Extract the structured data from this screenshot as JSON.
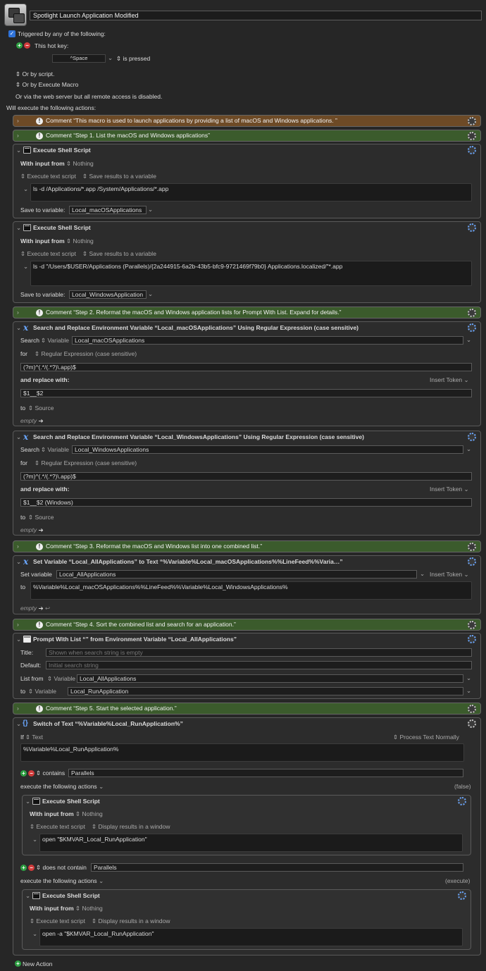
{
  "macro": {
    "name": "Spotlight Launch Application Modified"
  },
  "triggers": {
    "triggered_label": "Triggered by any of the following:",
    "hotkey_label": "This hot key:",
    "hotkey_value": "^Space",
    "hotkey_state": "is pressed",
    "by_script": "Or by script.",
    "by_execute": "Or by Execute Macro",
    "web": "Or via the web server but all remote access is disabled.",
    "will_execute": "Will execute the following actions:"
  },
  "common": {
    "execute_shell": "Execute Shell Script",
    "with_input": "With input from",
    "nothing": "Nothing",
    "execute_text": "Execute text script",
    "save_results": "Save results to a variable",
    "display_results": "Display results in a window",
    "save_to_var": "Save to variable:",
    "search": "Search",
    "variable": "Variable",
    "for": "for",
    "regex": "Regular Expression (case sensitive)",
    "replace_with": "and replace with:",
    "insert_token": "Insert Token",
    "to": "to",
    "source": "Source",
    "empty": "empty",
    "set_variable": "Set variable",
    "title": "Title:",
    "default": "Default:",
    "list_from": "List from",
    "if": "If",
    "text": "Text",
    "process_normally": "Process Text Normally",
    "contains": "contains",
    "does_not_contain": "does not contain",
    "execute_following": "execute the following actions",
    "false": "(false)",
    "execute": "(execute)",
    "new_action": "New Action"
  },
  "comments": {
    "c0": "Comment “This macro is used to launch applications by providing a list of macOS and Windows applications.  ”",
    "c1": "Comment “Step 1. List the macOS and Windows applications”",
    "c2": "Comment “Step 2. Reformat the macOS and Windows application lists for Prompt With List. Expand for details.”",
    "c3": "Comment “Step 3. Reformat the macOS and Windows list into one combined list.”",
    "c4": "Comment “Step 4. Sort the combined list and search for an application.”",
    "c5": "Comment “Step 5. Start the selected  application.”"
  },
  "shell1": {
    "script": "ls -d /Applications/*.app /System/Applications/*.app",
    "var": "Local_macOSApplications"
  },
  "shell2": {
    "script": "ls -d \"/Users/$USER/Applications (Parallels)/{2a244915-6a2b-43b5-bfc9-9721469f79b0} Applications.localized/\"*.app",
    "var": "Local_WindowsApplication"
  },
  "sr1": {
    "title": "Search and Replace Environment Variable “Local_macOSApplications” Using Regular Expression (case sensitive)",
    "var": "Local_macOSApplications",
    "regex": "(?m)^(.*/(.*?)\\.app)$",
    "replace": "$1__$2"
  },
  "sr2": {
    "title": "Search and Replace Environment Variable “Local_WindowsApplications” Using Regular Expression (case sensitive)",
    "var": "Local_WindowsApplications",
    "regex": "(?m)^(.*/(.*?)\\.app)$",
    "replace": "$1__$2 (Windows)"
  },
  "setvar": {
    "title": "Set Variable “Local_AllApplications” to Text “%Variable%Local_macOSApplications%%LineFeed%%Varia…”",
    "var": "Local_AllApplications",
    "text": "%Variable%Local_macOSApplications%%LineFeed%%Variable%Local_WindowsApplications%"
  },
  "prompt": {
    "title": "Prompt With List “” from Environment Variable “Local_AllApplications”",
    "title_ph": "Shown when search string is empty",
    "default_ph": "Initial search string",
    "list_var": "Local_AllApplications",
    "to_var": "Local_RunApplication"
  },
  "switch": {
    "title": "Switch of Text “%Variable%Local_RunApplication%”",
    "text": "%Variable%Local_RunApplication%",
    "case1": "Parallels",
    "case2": "Parallels",
    "script1": "open \"$KMVAR_Local_RunApplication\"",
    "script2": "open -a \"$KMVAR_Local_RunApplication\""
  },
  "colors": {
    "orange_comment": "#6d4a26",
    "green_comment": "#3b5b2c",
    "accent": "#2f72d8"
  },
  "icons": [
    "macro-icon",
    "checkbox-icon",
    "add-icon",
    "remove-icon",
    "disclosure-icon",
    "comment-icon",
    "gear-icon",
    "terminal-icon",
    "variable-x-icon",
    "window-icon",
    "braces-icon",
    "updown-icon",
    "chevron-down-icon",
    "arrow-right-icon",
    "return-icon"
  ]
}
